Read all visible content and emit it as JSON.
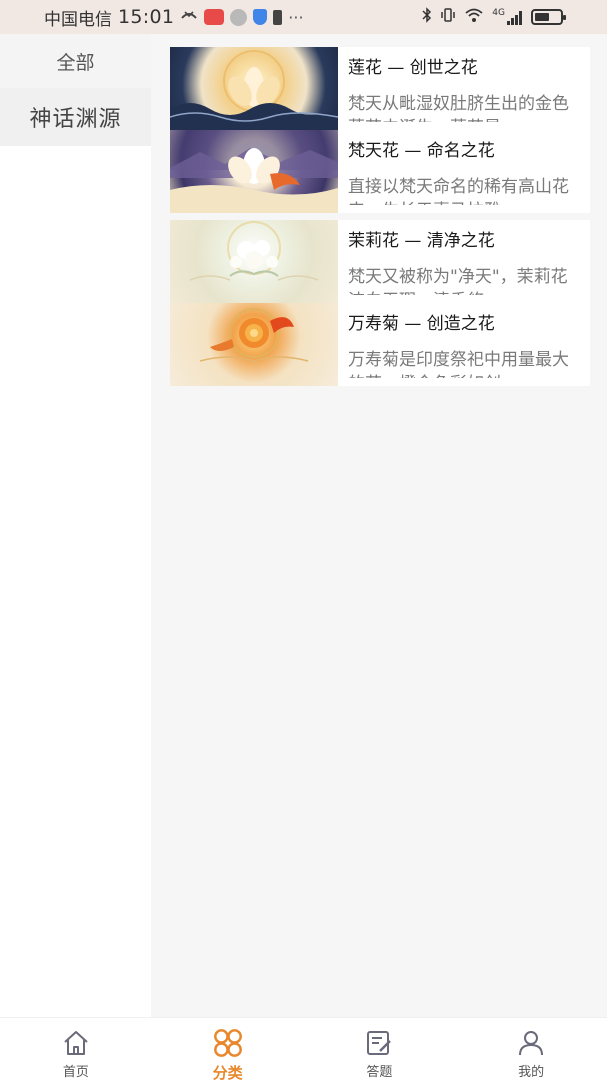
{
  "status_bar": {
    "carrier": "中国电信",
    "time": "15:01",
    "more": "···",
    "network": "4G"
  },
  "sidebar": {
    "items": [
      {
        "label": "全部"
      },
      {
        "label": "神话渊源"
      }
    ]
  },
  "list": {
    "items": [
      {
        "title": "莲花 — 创世之花",
        "desc": "梵天从毗湿奴肚脐生出的金色莲花中诞生，莲花是"
      },
      {
        "title": "梵天花 — 命名之花",
        "desc": "直接以梵天命名的稀有高山花卉，生长于喜马拉雅"
      },
      {
        "title": "茉莉花 — 清净之花",
        "desc": "梵天又被称为\"净天\"，茉莉花洁白无瑕，清香悠"
      },
      {
        "title": "万寿菊 — 创造之花",
        "desc": "万寿菊是印度祭祀中用量最大的花，橙金色彩如创"
      }
    ]
  },
  "bottom_nav": {
    "items": [
      {
        "label": "首页"
      },
      {
        "label": "分类"
      },
      {
        "label": "答题"
      },
      {
        "label": "我的"
      }
    ]
  },
  "colors": {
    "accent": "#e9872c",
    "nav_icon_inactive": "#6a6a7a"
  }
}
